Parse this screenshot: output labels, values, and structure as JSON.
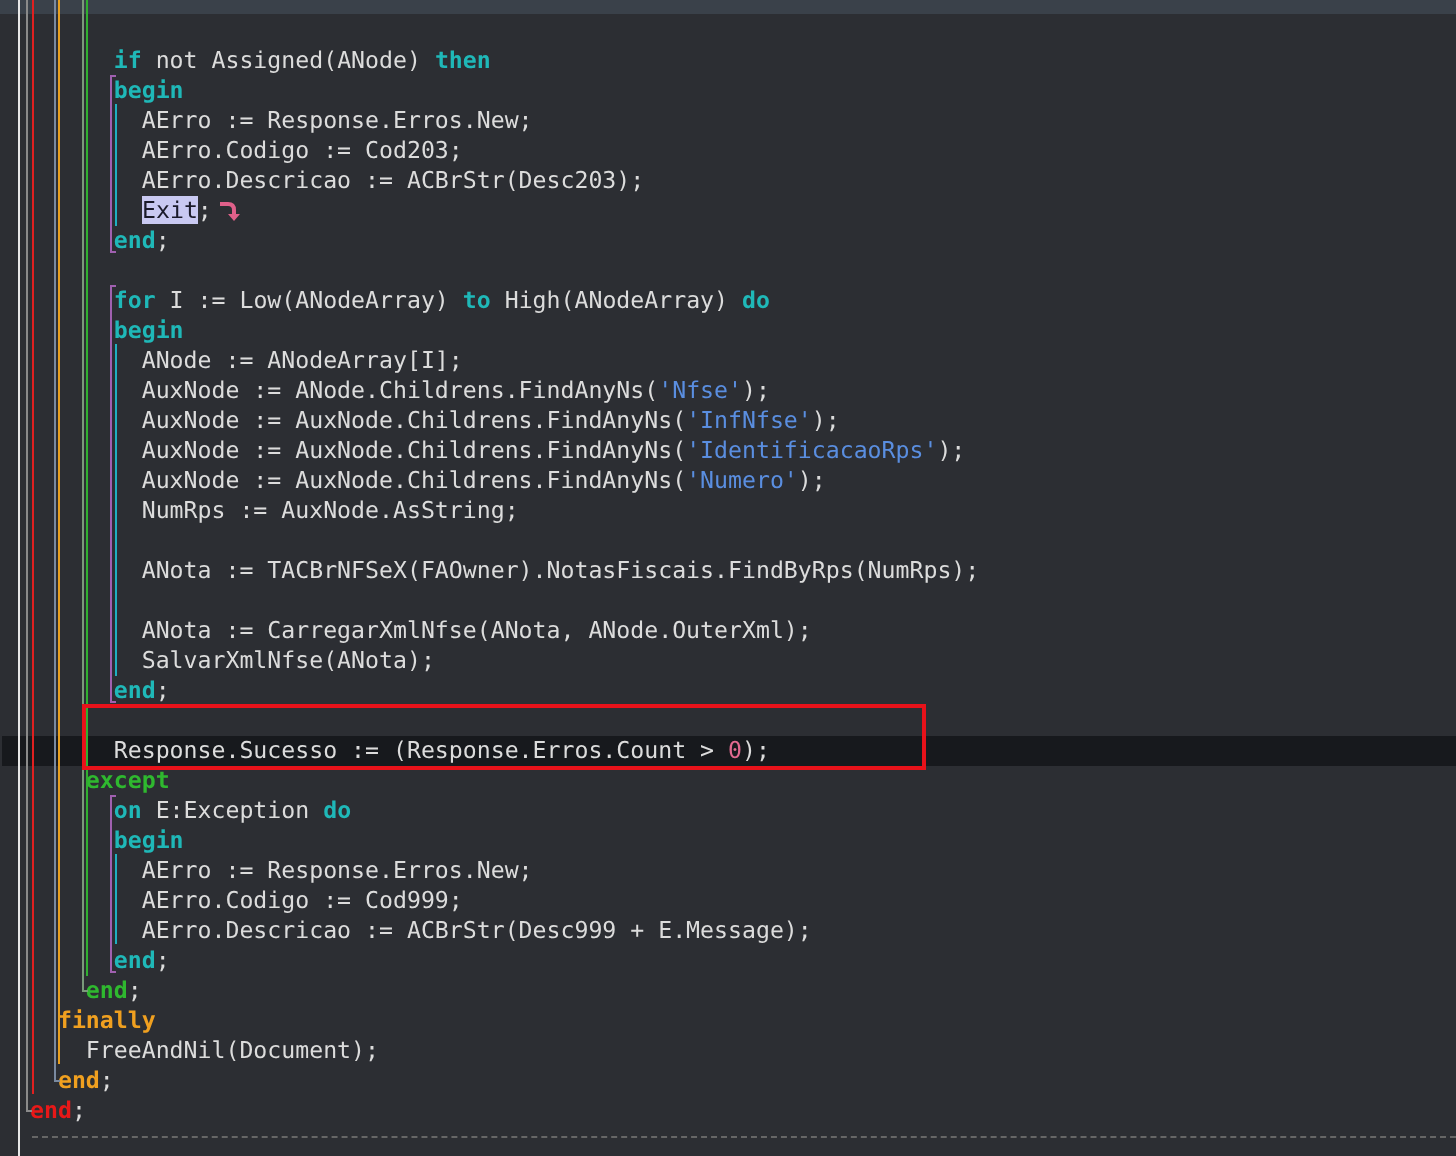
{
  "editor": {
    "lines": [
      {
        "current": false,
        "exit_arrow": false,
        "tokens": [
          {
            "text": "      if",
            "kind": "keyword"
          },
          {
            "text": " not Assigned(ANode) ",
            "kind": "plain"
          },
          {
            "text": "then",
            "kind": "keyword"
          }
        ]
      },
      {
        "current": false,
        "exit_arrow": false,
        "tokens": [
          {
            "text": "      begin",
            "kind": "keyword"
          }
        ]
      },
      {
        "current": false,
        "exit_arrow": false,
        "tokens": [
          {
            "text": "        AErro := Response.Erros.New;",
            "kind": "plain"
          }
        ]
      },
      {
        "current": false,
        "exit_arrow": false,
        "tokens": [
          {
            "text": "        AErro.Codigo := Cod203;",
            "kind": "plain"
          }
        ]
      },
      {
        "current": false,
        "exit_arrow": false,
        "tokens": [
          {
            "text": "        AErro.Descricao := ACBrStr(Desc203);",
            "kind": "plain"
          }
        ]
      },
      {
        "current": false,
        "exit_arrow": true,
        "tokens": [
          {
            "text": "Exit",
            "kind": "selected"
          },
          {
            "text": ";",
            "kind": "plain"
          }
        ]
      },
      {
        "current": false,
        "exit_arrow": false,
        "tokens": [
          {
            "text": "      end",
            "kind": "keyword"
          },
          {
            "text": ";",
            "kind": "plain"
          }
        ]
      },
      {
        "current": false,
        "exit_arrow": false
      },
      {
        "current": false,
        "exit_arrow": false,
        "tokens": [
          {
            "text": "      for",
            "kind": "keyword"
          },
          {
            "text": " I := Low(ANodeArray) ",
            "kind": "plain"
          },
          {
            "text": "to",
            "kind": "keyword"
          },
          {
            "text": " High(ANodeArray) ",
            "kind": "plain"
          },
          {
            "text": "do",
            "kind": "keyword"
          }
        ]
      },
      {
        "current": false,
        "exit_arrow": false,
        "tokens": [
          {
            "text": "      begin",
            "kind": "keyword"
          }
        ]
      },
      {
        "current": false,
        "exit_arrow": false,
        "tokens": [
          {
            "text": "        ANode := ANodeArray[I];",
            "kind": "plain"
          }
        ]
      },
      {
        "current": false,
        "exit_arrow": false,
        "tokens": [
          {
            "text": "        AuxNode := ANode.Childrens.FindAnyNs(",
            "kind": "plain"
          },
          {
            "text": "'Nfse'",
            "kind": "string"
          },
          {
            "text": ");",
            "kind": "plain"
          }
        ]
      },
      {
        "current": false,
        "exit_arrow": false,
        "tokens": [
          {
            "text": "        AuxNode := AuxNode.Childrens.FindAnyNs(",
            "kind": "plain"
          },
          {
            "text": "'InfNfse'",
            "kind": "string"
          },
          {
            "text": ");",
            "kind": "plain"
          }
        ]
      },
      {
        "current": false,
        "exit_arrow": false,
        "tokens": [
          {
            "text": "        AuxNode := AuxNode.Childrens.FindAnyNs(",
            "kind": "plain"
          },
          {
            "text": "'IdentificacaoRps'",
            "kind": "string"
          },
          {
            "text": ");",
            "kind": "plain"
          }
        ]
      },
      {
        "current": false,
        "exit_arrow": false,
        "tokens": [
          {
            "text": "        AuxNode := AuxNode.Childrens.FindAnyNs(",
            "kind": "plain"
          },
          {
            "text": "'Numero'",
            "kind": "string"
          },
          {
            "text": ");",
            "kind": "plain"
          }
        ]
      },
      {
        "current": false,
        "exit_arrow": false,
        "tokens": [
          {
            "text": "        NumRps := AuxNode.AsString;",
            "kind": "plain"
          }
        ]
      },
      {
        "current": false,
        "exit_arrow": false
      },
      {
        "current": false,
        "exit_arrow": false,
        "tokens": [
          {
            "text": "        ANota := TACBrNFSeX(FAOwner).NotasFiscais.FindByRps(NumRps);",
            "kind": "plain"
          }
        ]
      },
      {
        "current": false,
        "exit_arrow": false
      },
      {
        "current": false,
        "exit_arrow": false,
        "tokens": [
          {
            "text": "        ANota := CarregarXmlNfse(ANota, ANode.OuterXml);",
            "kind": "plain"
          }
        ]
      },
      {
        "current": false,
        "exit_arrow": false,
        "tokens": [
          {
            "text": "        SalvarXmlNfse(ANota);",
            "kind": "plain"
          }
        ]
      },
      {
        "current": false,
        "exit_arrow": false,
        "tokens": [
          {
            "text": "      end",
            "kind": "keyword"
          },
          {
            "text": ";",
            "kind": "plain"
          }
        ]
      },
      {
        "current": false,
        "exit_arrow": false
      },
      {
        "current": true,
        "exit_arrow": false,
        "tokens": [
          {
            "text": "      Response.Sucesso := (Response.Erros.Count > ",
            "kind": "plain"
          },
          {
            "text": "0",
            "kind": "number"
          },
          {
            "text": ");",
            "kind": "plain"
          }
        ]
      },
      {
        "current": false,
        "exit_arrow": false,
        "tokens": [
          {
            "text": "    except",
            "kind": "try-keyword"
          }
        ]
      },
      {
        "current": false,
        "exit_arrow": false,
        "tokens": [
          {
            "text": "      on",
            "kind": "keyword"
          },
          {
            "text": " E:Exception ",
            "kind": "plain"
          },
          {
            "text": "do",
            "kind": "keyword"
          }
        ]
      },
      {
        "current": false,
        "exit_arrow": false,
        "tokens": [
          {
            "text": "      begin",
            "kind": "keyword"
          }
        ]
      },
      {
        "current": false,
        "exit_arrow": false,
        "tokens": [
          {
            "text": "        AErro := Response.Erros.New;",
            "kind": "plain"
          }
        ]
      },
      {
        "current": false,
        "exit_arrow": false,
        "tokens": [
          {
            "text": "        AErro.Codigo := Cod999;",
            "kind": "plain"
          }
        ]
      },
      {
        "current": false,
        "exit_arrow": false,
        "tokens": [
          {
            "text": "        AErro.Descricao := ACBrStr(Desc999 + E.Message);",
            "kind": "plain"
          }
        ]
      },
      {
        "current": false,
        "exit_arrow": false,
        "tokens": [
          {
            "text": "      end",
            "kind": "keyword"
          },
          {
            "text": ";",
            "kind": "plain"
          }
        ]
      },
      {
        "current": false,
        "exit_arrow": false,
        "tokens": [
          {
            "text": "    end",
            "kind": "try-keyword"
          },
          {
            "text": ";",
            "kind": "plain"
          }
        ]
      },
      {
        "current": false,
        "exit_arrow": false,
        "tokens": [
          {
            "text": "  finally",
            "kind": "finally-keyword"
          }
        ]
      },
      {
        "current": false,
        "exit_arrow": false,
        "tokens": [
          {
            "text": "    FreeAndNil(Document);",
            "kind": "plain"
          }
        ]
      },
      {
        "current": false,
        "exit_arrow": false,
        "tokens": [
          {
            "text": "  end",
            "kind": "finally-keyword"
          },
          {
            "text": ";",
            "kind": "plain"
          }
        ]
      },
      {
        "current": false,
        "exit_arrow": false,
        "tokens": [
          {
            "text": "end",
            "kind": "outer-keyword"
          },
          {
            "text": ";",
            "kind": "plain"
          }
        ]
      }
    ]
  }
}
